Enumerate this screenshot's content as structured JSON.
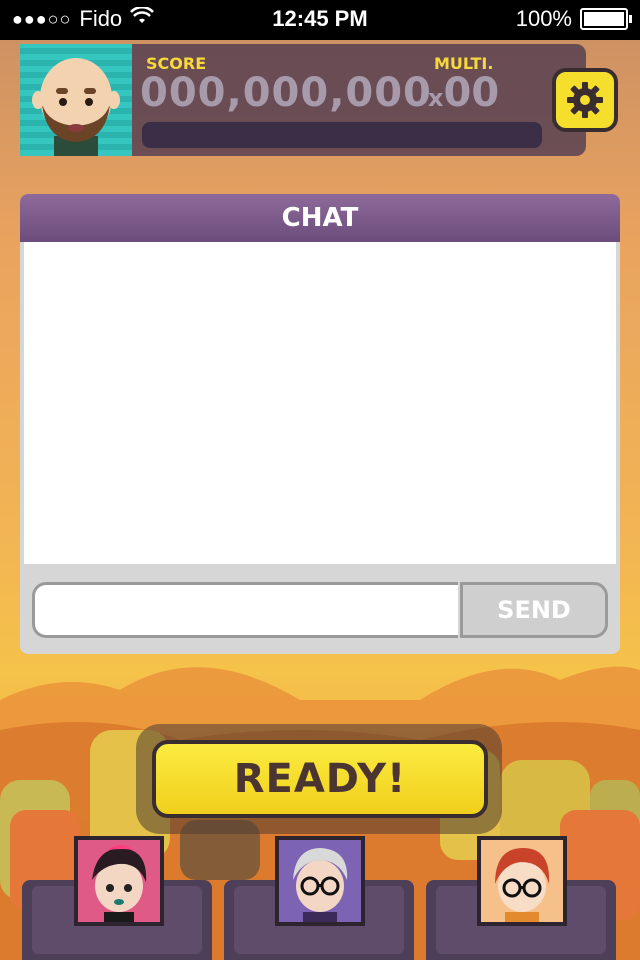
{
  "status_bar": {
    "carrier": "Fido",
    "signal_dots": "●●●○○",
    "time": "12:45 PM",
    "battery": "100%"
  },
  "hud": {
    "score_label": "SCORE",
    "score_value": "000,000,000",
    "multi_label": "MULTI.",
    "multi_prefix": "x",
    "multi_value": "00",
    "progress_fraction": 0,
    "settings_icon": "gear-icon"
  },
  "chat": {
    "title": "CHAT",
    "input_value": "",
    "input_placeholder": "",
    "send_label": "SEND",
    "messages": []
  },
  "ready": {
    "label": "READY!"
  },
  "players": [
    {
      "avatar": "pink-hair-girl"
    },
    {
      "avatar": "gray-hair-glasses"
    },
    {
      "avatar": "red-hair-glasses"
    }
  ],
  "colors": {
    "accent_yellow": "#f6df2c",
    "panel_purple": "#6b4d7c",
    "label_yellow": "#f7d93b"
  }
}
